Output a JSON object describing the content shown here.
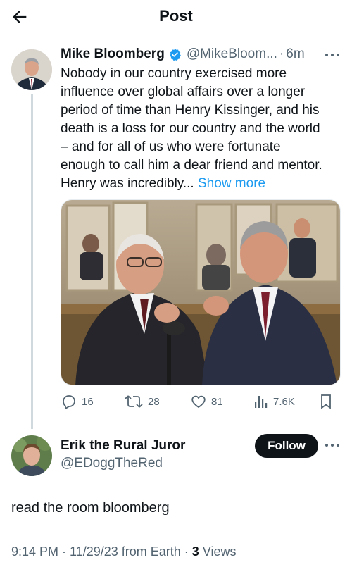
{
  "header": {
    "title": "Post",
    "back_icon": "arrow-left-icon"
  },
  "tweet": {
    "author_name": "Mike Bloomberg",
    "verified_color": "#1d9bf0",
    "handle": "@MikeBloom...",
    "separator": "·",
    "time": "6m",
    "text_lines": [
      "Nobody in our country exercised more",
      "influence over global affairs over a longer",
      "period of time than Henry Kissinger, and his",
      "death is a loss for our country and the world",
      "– and for all of us who were fortunate",
      "enough to call him a dear friend and mentor.",
      "Henry was incredibly... "
    ],
    "show_more": "Show more",
    "accent_color": "#1d9bf0",
    "actions": {
      "replies": "16",
      "reposts": "28",
      "likes": "81",
      "views": "7.6K"
    }
  },
  "reply": {
    "author_name": "Erik the Rural Juror",
    "handle": "@EDoggTheRed",
    "follow_label": "Follow",
    "text": "read the room bloomberg",
    "meta_prefix": "9:14 PM · 11/29/23 from Earth · ",
    "views_count": "3",
    "views_label": " Views"
  }
}
